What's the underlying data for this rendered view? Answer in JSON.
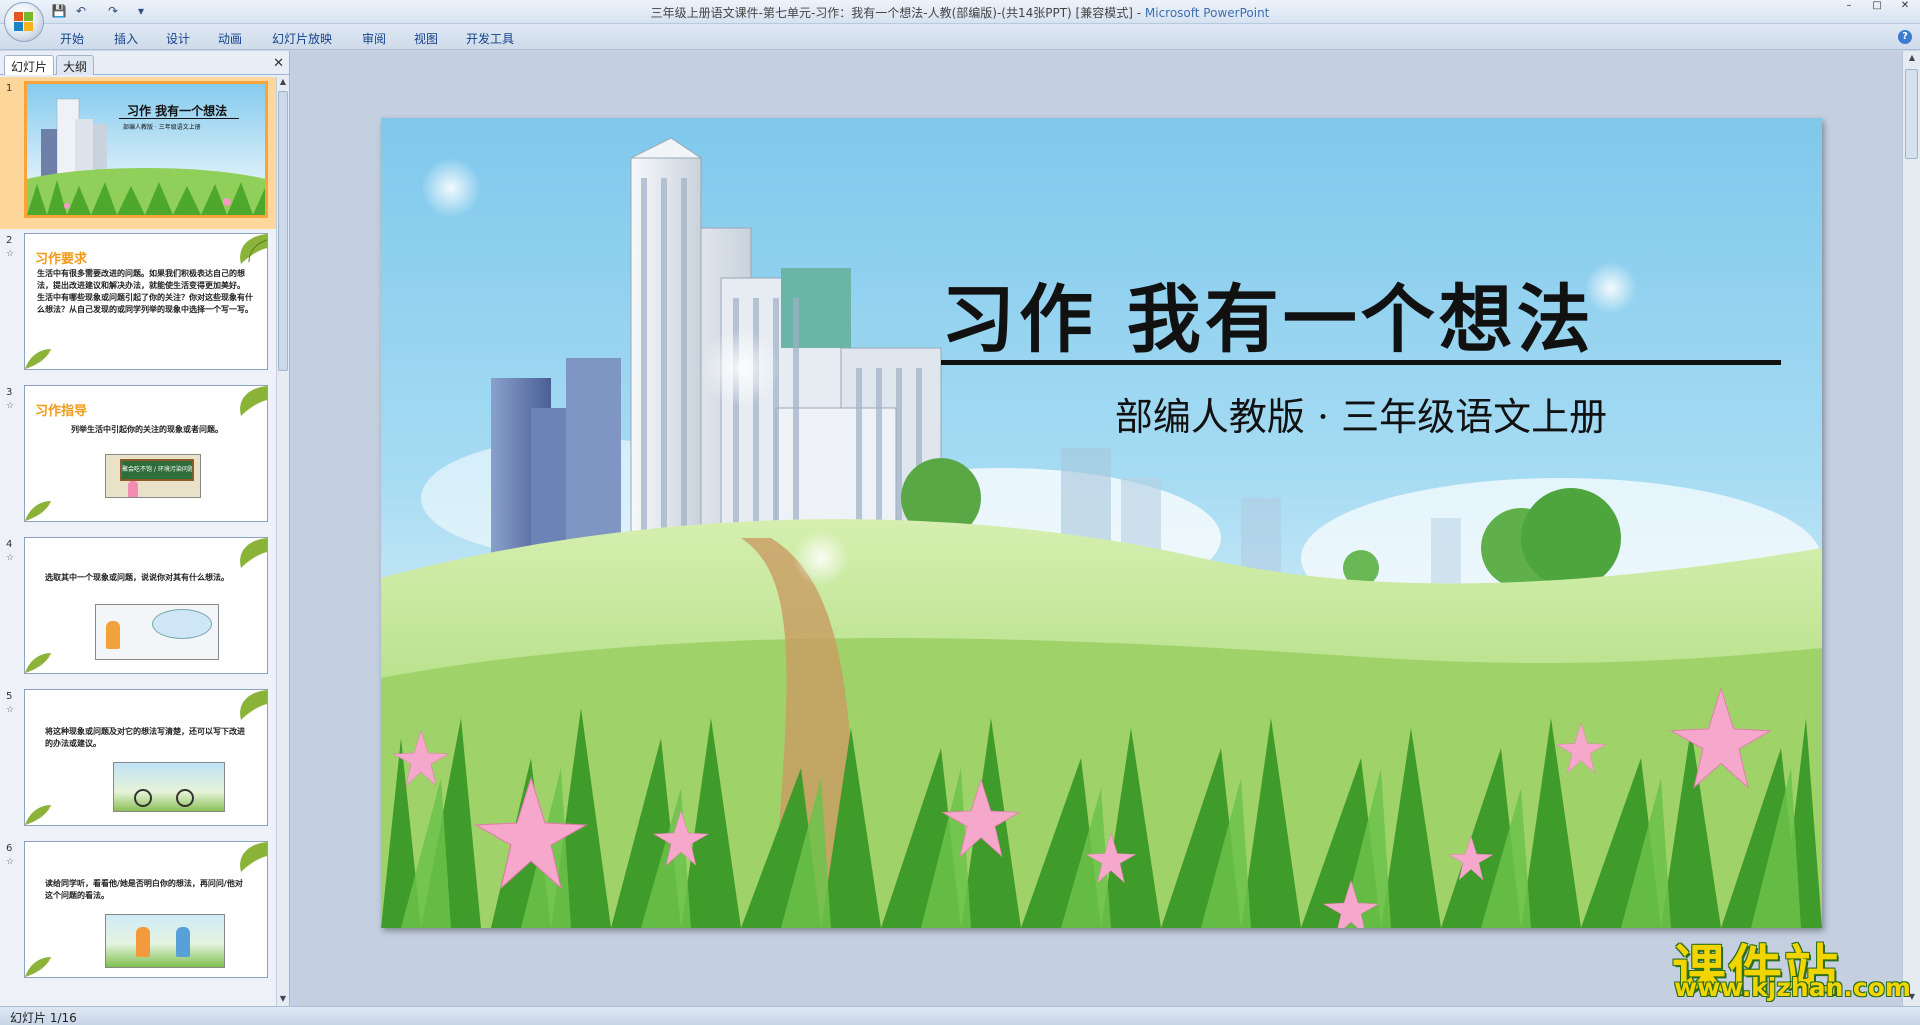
{
  "window": {
    "title_doc": "三年级上册语文课件-第七单元-习作：我有一个想法-人教(部编版)-(共14张PPT) [兼容模式] - ",
    "title_app": "Microsoft PowerPoint",
    "minimize": "–",
    "maximize": "□",
    "close": "✕"
  },
  "qat": {
    "save": "💾",
    "undo": "↶",
    "redo": "↷",
    "more": "▾"
  },
  "ribbon": {
    "tabs": [
      "开始",
      "插入",
      "设计",
      "动画",
      "幻灯片放映",
      "审阅",
      "视图",
      "开发工具"
    ],
    "help": "?"
  },
  "pane": {
    "tabs": [
      "幻灯片",
      "大纲"
    ],
    "close": "✕",
    "slides": [
      {
        "num": "1",
        "title": "习作  我有一个想法",
        "subtitle": "部编人教版 · 三年级语文上册"
      },
      {
        "num": "2",
        "star": "☆",
        "title": "习作要求",
        "body": "生活中有很多需要改进的问题。如果我们积极表达自己的想法，提出改进建议和解决办法，就能使生活变得更加美好。 生活中有哪些现象或问题引起了你的关注？你对这些现象有什么想法？从自己发现的或同学列举的现象中选择一个写一写。"
      },
      {
        "num": "3",
        "star": "☆",
        "title": "习作指导",
        "body": "列举生活中引起你的关注的现象或者问题。",
        "board": "聚会吃不饱 / 环境污染问题"
      },
      {
        "num": "4",
        "star": "☆",
        "body": "选取其中一个现象或问题，说说你对其有什么想法。"
      },
      {
        "num": "5",
        "star": "☆",
        "body": "将这种现象或问题及对它的想法写清楚，还可以写下改进的办法或建议。"
      },
      {
        "num": "6",
        "star": "☆",
        "body": "读给同学听，看看他/她是否明白你的想法，再问问/他对这个问题的看法。"
      }
    ]
  },
  "slide": {
    "title": "习作  我有一个想法",
    "subtitle": "部编人教版 · 三年级语文上册"
  },
  "status": {
    "text": "幻灯片 1/16"
  },
  "watermark": {
    "cn": "课件站",
    "url": "www.kjzhan.com"
  },
  "colors": {
    "accent_orange": "#f29a17",
    "selection": "#fcd69a",
    "ribbon_text": "#15428b",
    "watermark": "#f2d400"
  }
}
